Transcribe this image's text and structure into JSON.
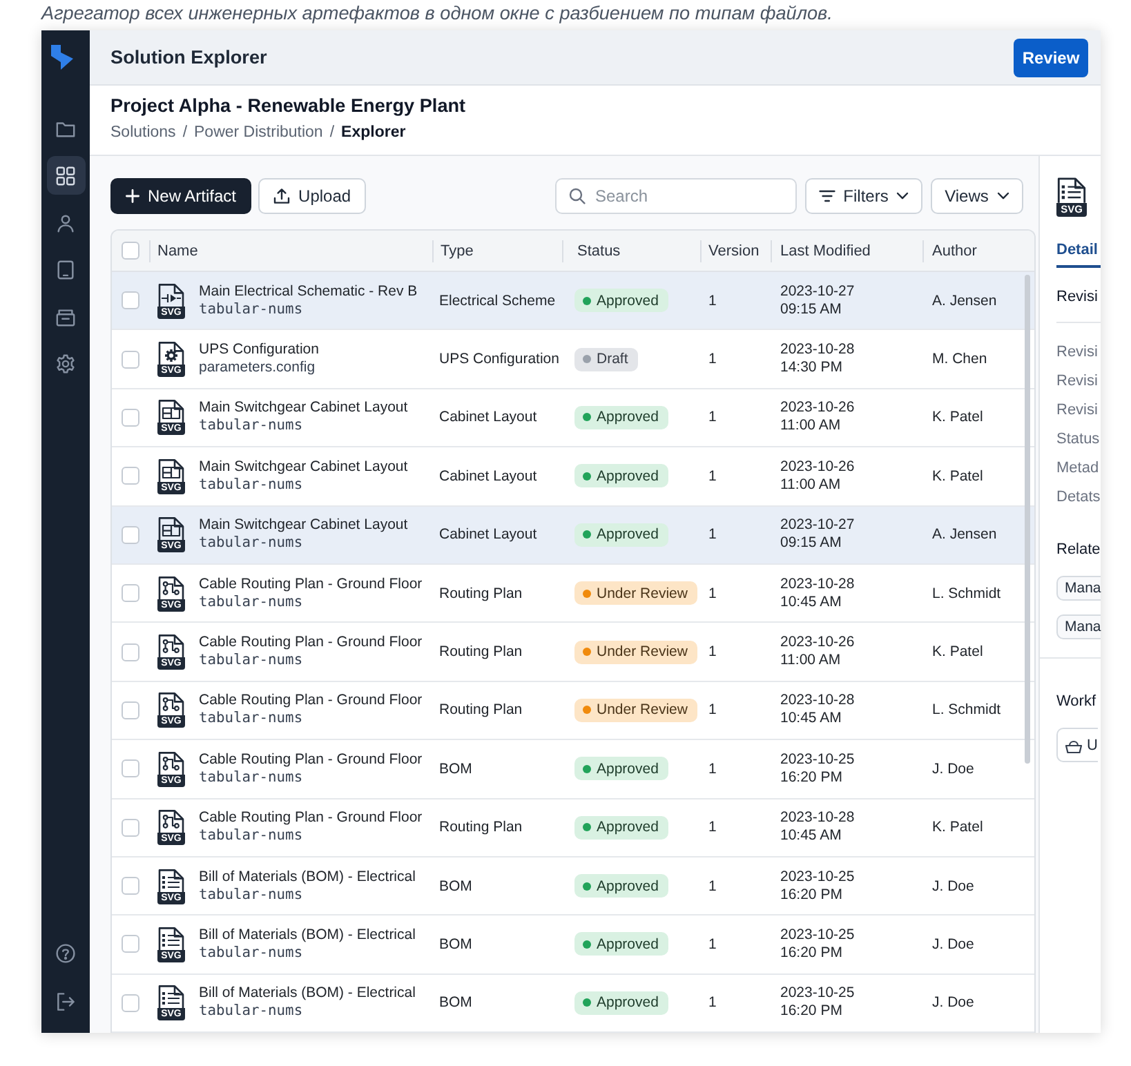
{
  "caption": "Агрегатор всех инженерных артефактов в одном окне с разбиением по типам файлов.",
  "sidebar": {
    "items": [
      {
        "kind": "folder",
        "selected": false
      },
      {
        "kind": "grid",
        "selected": true
      },
      {
        "kind": "user",
        "selected": false
      },
      {
        "kind": "tablet",
        "selected": false
      },
      {
        "kind": "tray",
        "selected": false
      },
      {
        "kind": "settings",
        "selected": false
      }
    ],
    "bottom_items": [
      {
        "kind": "help"
      },
      {
        "kind": "logout"
      }
    ]
  },
  "app_bar": {
    "title": "Solution Explorer",
    "review_button": "Review"
  },
  "project": {
    "title": "Project Alpha - Renewable Energy Plant",
    "breadcrumb": [
      {
        "label": "Solutions",
        "current": false
      },
      {
        "separator": "/",
        "label": "Power Distribution",
        "current": false
      },
      {
        "separator": "/",
        "label": "Explorer",
        "current": true
      }
    ]
  },
  "toolbar": {
    "new_button": "New Artifact",
    "upload_button": "Upload",
    "search": {
      "placeholder": "Search"
    },
    "filters_button": "Filters",
    "views_button": "Views"
  },
  "table": {
    "select_all_checked": false,
    "columns": [
      "Name",
      "Type",
      "Status",
      "Version",
      "Last Modified",
      "Author"
    ],
    "rows": [
      {
        "selected": true,
        "checked": false,
        "kind": "schematic",
        "badge": "SVG",
        "name": "Main Electrical Schematic - Rev B",
        "file": "tabular-nums",
        "file_monospace": true,
        "type": "Electrical Scheme",
        "status": {
          "label": "Approved",
          "kind": "approved"
        },
        "version": "1",
        "modified": "2023-10-27 09:15 AM",
        "author": "A. Jensen"
      },
      {
        "selected": false,
        "checked": false,
        "kind": "config",
        "badge": "SVG",
        "name": "UPS Configuration",
        "file": "parameters.config",
        "file_monospace": false,
        "type": "UPS Configuration",
        "status": {
          "label": "Draft",
          "kind": "draft"
        },
        "version": "1",
        "modified": "2023-10-28 14:30 PM",
        "author": "M. Chen"
      },
      {
        "selected": false,
        "checked": false,
        "kind": "cabinet",
        "badge": "SVG",
        "name": "Main Switchgear Cabinet Layout",
        "file": "tabular-nums",
        "file_monospace": true,
        "type": "Cabinet Layout",
        "status": {
          "label": "Approved",
          "kind": "approved"
        },
        "version": "1",
        "modified": "2023-10-26 11:00 AM",
        "author": "K. Patel"
      },
      {
        "selected": false,
        "checked": false,
        "kind": "cabinet",
        "badge": "SVG",
        "name": "Main Switchgear Cabinet Layout",
        "file": "tabular-nums",
        "file_monospace": true,
        "type": "Cabinet Layout",
        "status": {
          "label": "Approved",
          "kind": "approved"
        },
        "version": "1",
        "modified": "2023-10-26 11:00 AM",
        "author": "K. Patel"
      },
      {
        "selected": true,
        "checked": false,
        "kind": "cabinet",
        "badge": "SVG",
        "name": "Main Switchgear Cabinet Layout",
        "file": "tabular-nums",
        "file_monospace": true,
        "type": "Cabinet Layout",
        "status": {
          "label": "Approved",
          "kind": "approved"
        },
        "version": "1",
        "modified": "2023-10-27 09:15 AM",
        "author": "A. Jensen"
      },
      {
        "selected": false,
        "checked": false,
        "kind": "routing",
        "badge": "SVG",
        "name": "Cable Routing Plan - Ground Floor",
        "file": "tabular-nums",
        "file_monospace": true,
        "type": "Routing Plan",
        "status": {
          "label": "Under Review",
          "kind": "review"
        },
        "version": "1",
        "modified": "2023-10-28 10:45 AM",
        "author": "L. Schmidt"
      },
      {
        "selected": false,
        "checked": false,
        "kind": "routing",
        "badge": "SVG",
        "name": "Cable Routing Plan - Ground Floor",
        "file": "tabular-nums",
        "file_monospace": true,
        "type": "Routing Plan",
        "status": {
          "label": "Under Review",
          "kind": "review"
        },
        "version": "1",
        "modified": "2023-10-26 11:00 AM",
        "author": "K. Patel"
      },
      {
        "selected": false,
        "checked": false,
        "kind": "routing",
        "badge": "SVG",
        "name": "Cable Routing Plan - Ground Floor",
        "file": "tabular-nums",
        "file_monospace": true,
        "type": "Routing Plan",
        "status": {
          "label": "Under Review",
          "kind": "review"
        },
        "version": "1",
        "modified": "2023-10-28 10:45 AM",
        "author": "L. Schmidt"
      },
      {
        "selected": false,
        "checked": false,
        "kind": "routing",
        "badge": "SVG",
        "name": "Cable Routing Plan - Ground Floor",
        "file": "tabular-nums",
        "file_monospace": true,
        "type": "BOM",
        "status": {
          "label": "Approved",
          "kind": "approved"
        },
        "version": "1",
        "modified": "2023-10-25 16:20 PM",
        "author": "J. Doe"
      },
      {
        "selected": false,
        "checked": false,
        "kind": "routing",
        "badge": "SVG",
        "name": "Cable Routing Plan - Ground Floor",
        "file": "tabular-nums",
        "file_monospace": true,
        "type": "Routing Plan",
        "status": {
          "label": "Approved",
          "kind": "approved"
        },
        "version": "1",
        "modified": "2023-10-28 10:45 AM",
        "author": "K. Patel"
      },
      {
        "selected": false,
        "checked": false,
        "kind": "bom",
        "badge": "SVG",
        "name": "Bill of Materials (BOM) - Electrical",
        "file": "tabular-nums",
        "file_monospace": true,
        "type": "BOM",
        "status": {
          "label": "Approved",
          "kind": "approved"
        },
        "version": "1",
        "modified": "2023-10-25 16:20 PM",
        "author": "J. Doe"
      },
      {
        "selected": false,
        "checked": false,
        "kind": "bom",
        "badge": "SVG",
        "name": "Bill of Materials (BOM) - Electrical",
        "file": "tabular-nums",
        "file_monospace": true,
        "type": "BOM",
        "status": {
          "label": "Approved",
          "kind": "approved"
        },
        "version": "1",
        "modified": "2023-10-25 16:20 PM",
        "author": "J. Doe"
      },
      {
        "selected": false,
        "checked": false,
        "kind": "bom",
        "badge": "SVG",
        "name": "Bill of Materials (BOM) - Electrical",
        "file": "tabular-nums",
        "file_monospace": true,
        "type": "BOM",
        "status": {
          "label": "Approved",
          "kind": "approved"
        },
        "version": "1",
        "modified": "2023-10-25 16:20 PM",
        "author": "J. Doe"
      }
    ]
  },
  "details_panel": {
    "file_icon": {
      "kind": "bom",
      "badge": "SVG"
    },
    "tabs": [
      {
        "label": "Detail",
        "selected": true
      }
    ],
    "section_title": "Revisi",
    "fields": [
      "Revisi",
      "Revisi",
      "Revisi",
      "Status",
      "Metad",
      "Detats"
    ],
    "related": {
      "title": "Relate",
      "items": [
        "Mana",
        "Mana"
      ]
    },
    "workflow": {
      "title": "Workf",
      "button": "U"
    }
  }
}
